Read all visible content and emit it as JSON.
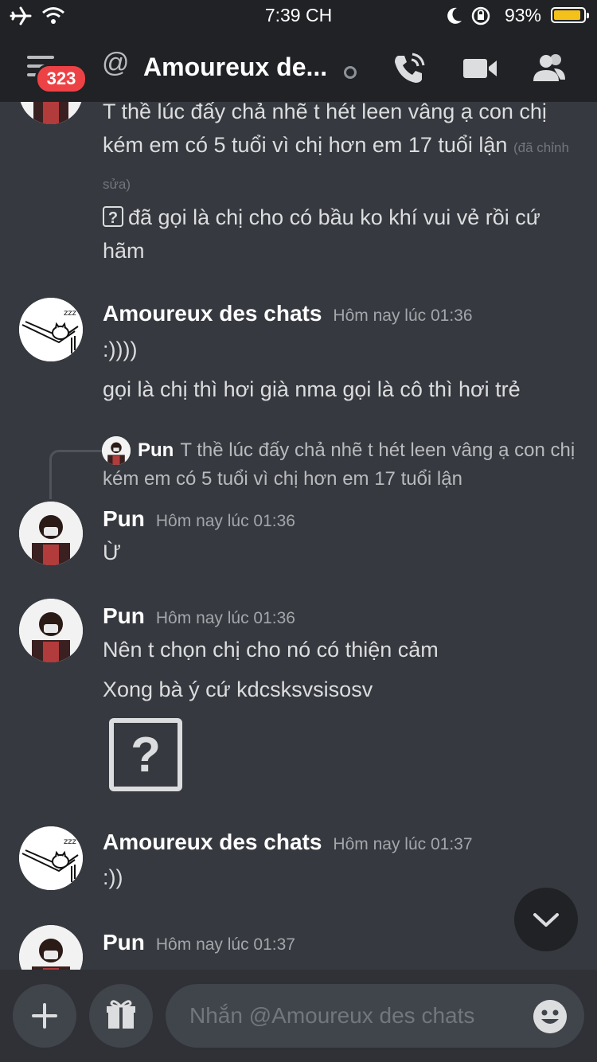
{
  "status_bar": {
    "time": "7:39 CH",
    "battery_percent": "93%",
    "battery_level": 0.93
  },
  "header": {
    "unread_count": "323",
    "channel_title": "Amoureux de..."
  },
  "messages": {
    "cont1": "T thề lúc đấy chả nhẽ t hét leen vâng ạ con chị kém em có 5 tuổi vì chị hơn em 17 tuổi lận",
    "edited": "(đã chỉnh sửa)",
    "cont2": "đã gọi là chị cho có bầu ko khí vui vẻ rồi cứ hãm",
    "m1": {
      "author": "Amoureux des chats",
      "time": "Hôm nay lúc 01:36",
      "line1": ":))))",
      "line2": "gọi là chị thì hơi già nma gọi là cô thì hơi trẻ"
    },
    "reply": {
      "author": "Pun",
      "text": "T thề lúc đấy chả nhẽ t hét leen vâng ạ con chị kém em có 5 tuổi vì chị hơn em 17 tuổi lận"
    },
    "m2": {
      "author": "Pun",
      "time": "Hôm nay lúc 01:36",
      "line1": "Ừ"
    },
    "m3": {
      "author": "Pun",
      "time": "Hôm nay lúc 01:36",
      "line1": "Nên t chọn chị cho nó có thiện cảm",
      "line2": "Xong bà ý cứ kdcsksvsisosv"
    },
    "m4": {
      "author": "Amoureux des chats",
      "time": "Hôm nay lúc 01:37",
      "line1": ":))"
    },
    "m5": {
      "author": "Pun",
      "time": "Hôm nay lúc 01:37"
    }
  },
  "composer": {
    "placeholder": "Nhắn @Amoureux des chats"
  }
}
